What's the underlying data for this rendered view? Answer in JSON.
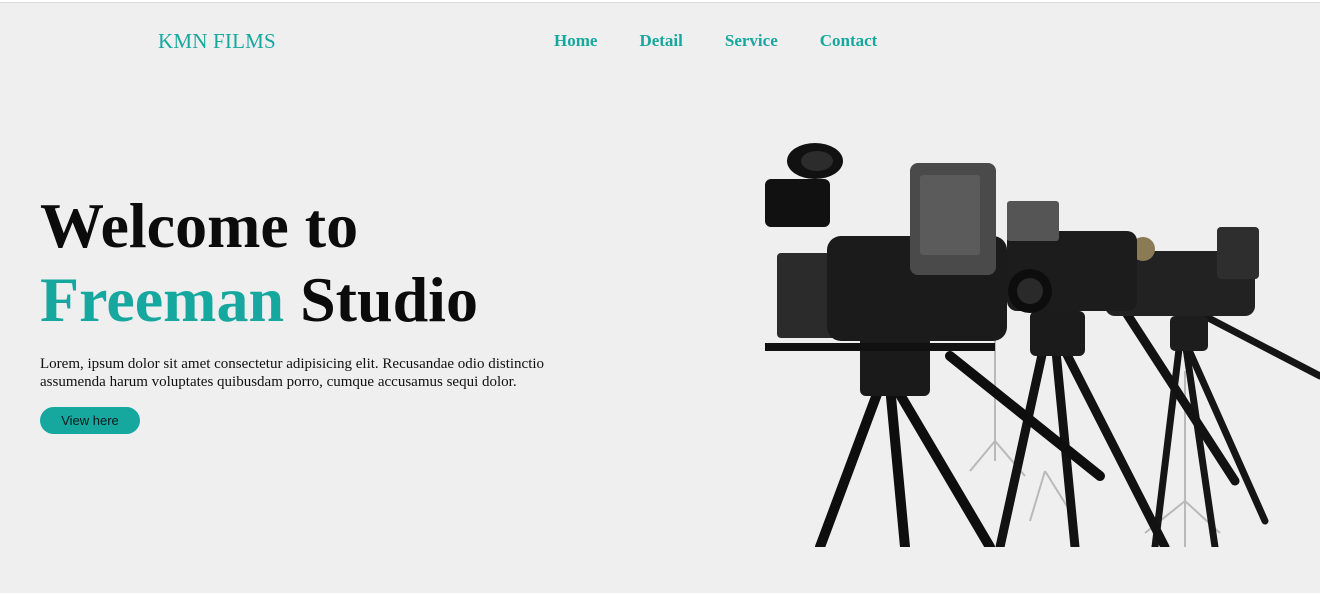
{
  "header": {
    "brand": "KMN FILMS",
    "nav": [
      "Home",
      "Detail",
      "Service",
      "Contact"
    ]
  },
  "hero": {
    "title_line1": "Welcome to",
    "title_accent": "Freeman",
    "title_rest": "Studio",
    "description": "Lorem, ipsum dolor sit amet consectetur adipisicing elit. Recusandae odio distinctio assumenda harum voluptates quibusdam porro, cumque accusamus sequi dolor.",
    "button_label": "View here",
    "image_icon": "video-cameras-on-tripods-image"
  },
  "colors": {
    "accent": "#16a89e",
    "background": "#efefef",
    "text": "#0b0b0b"
  }
}
